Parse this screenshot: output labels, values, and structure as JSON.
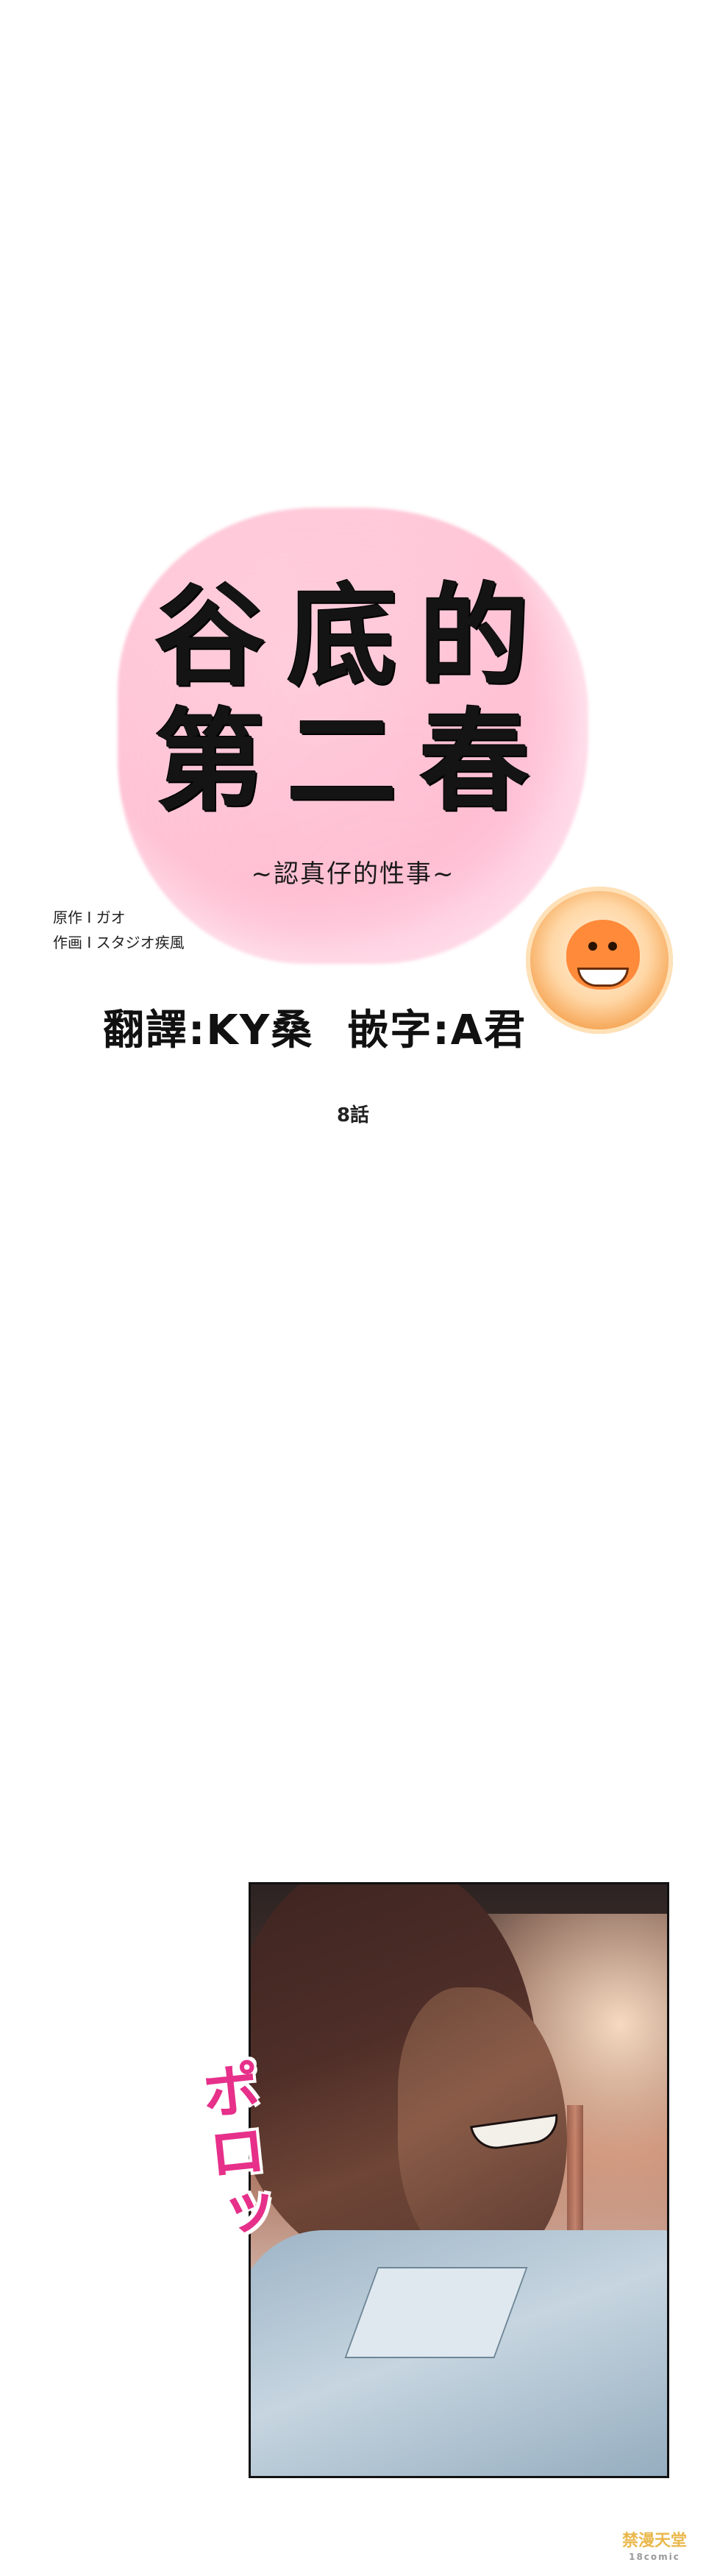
{
  "title": {
    "line1": "谷底的",
    "line2": "第二春",
    "subtitle": "~認真仔的性事~"
  },
  "credits": {
    "original": "原作 I ガオ",
    "art": "作画 I スタジオ疾風"
  },
  "staff": {
    "translator": "翻譯:KY桑",
    "typesetter": "嵌字:A君"
  },
  "chapter": {
    "label": "8話"
  },
  "panel": {
    "sfx": "ポロッ"
  },
  "watermark": {
    "main": "禁漫天堂",
    "sub": "18comic"
  },
  "logo": {
    "icon": "orange-mascot-icon"
  },
  "colors": {
    "title_pink": "#ffc4d8",
    "sfx_pink": "#e6308a",
    "logo_orange": "#ff8a3a",
    "watermark_gold": "#e9b84d"
  }
}
